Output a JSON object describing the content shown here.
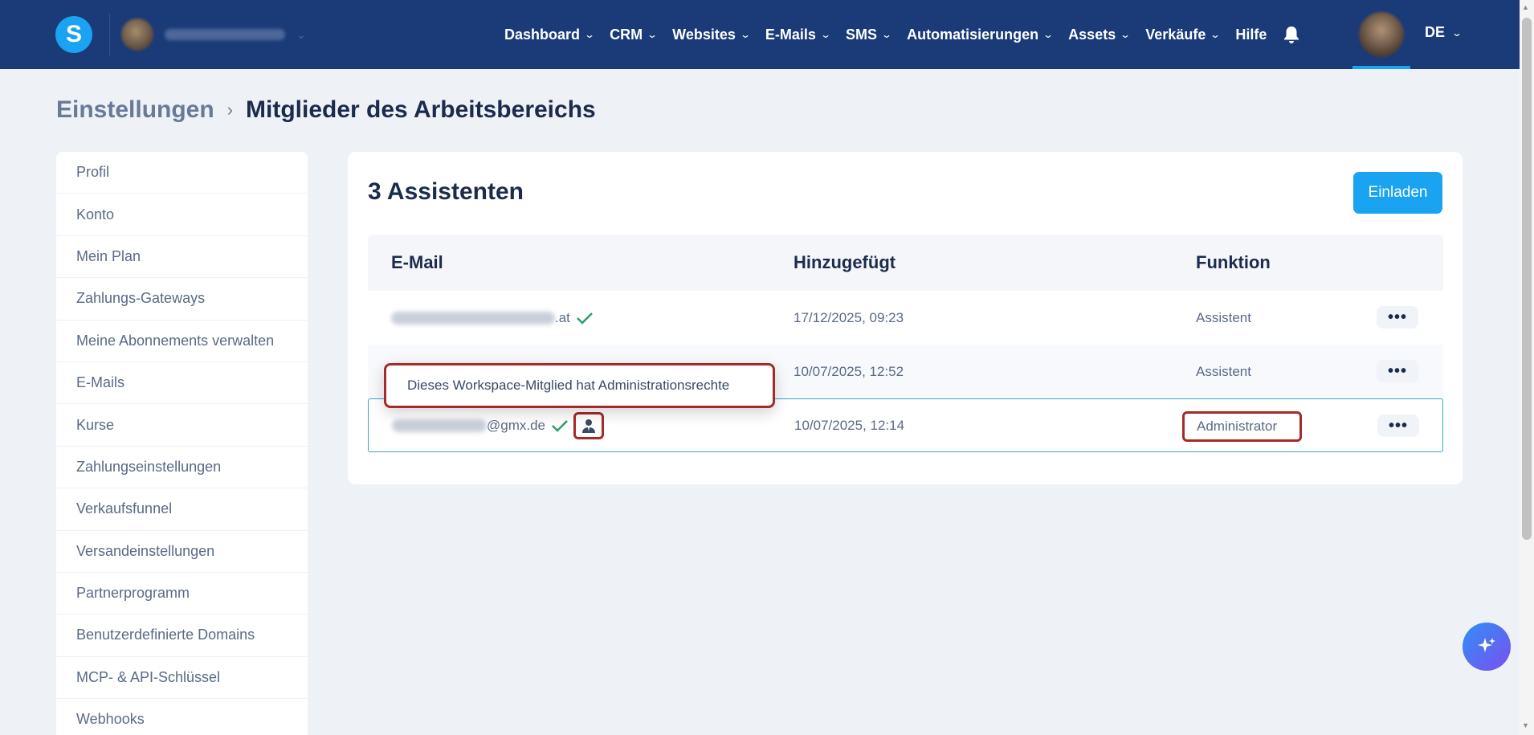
{
  "app": {
    "logo_letter": "S",
    "language": "DE"
  },
  "nav": {
    "items": [
      {
        "label": "Dashboard",
        "has_dropdown": true
      },
      {
        "label": "CRM",
        "has_dropdown": true
      },
      {
        "label": "Websites",
        "has_dropdown": true
      },
      {
        "label": "E-Mails",
        "has_dropdown": true
      },
      {
        "label": "SMS",
        "has_dropdown": true
      },
      {
        "label": "Automatisierungen",
        "has_dropdown": true
      },
      {
        "label": "Assets",
        "has_dropdown": true
      },
      {
        "label": "Verkäufe",
        "has_dropdown": true
      },
      {
        "label": "Hilfe",
        "has_dropdown": false
      }
    ]
  },
  "breadcrumb": {
    "root": "Einstellungen",
    "current": "Mitglieder des Arbeitsbereichs"
  },
  "sidebar": {
    "items": [
      {
        "label": "Profil"
      },
      {
        "label": "Konto"
      },
      {
        "label": "Mein Plan"
      },
      {
        "label": "Zahlungs-Gateways"
      },
      {
        "label": "Meine Abonnements verwalten"
      },
      {
        "label": "E-Mails"
      },
      {
        "label": "Kurse"
      },
      {
        "label": "Zahlungseinstellungen"
      },
      {
        "label": "Verkaufsfunnel"
      },
      {
        "label": "Versandeinstellungen"
      },
      {
        "label": "Partnerprogramm"
      },
      {
        "label": "Benutzerdefinierte Domains"
      },
      {
        "label": "MCP- & API-Schlüssel"
      },
      {
        "label": "Webhooks"
      }
    ]
  },
  "main": {
    "title": "3 Assistenten",
    "invite_label": "Einladen",
    "table": {
      "headers": {
        "email": "E-Mail",
        "added": "Hinzugefügt",
        "role": "Funktion"
      },
      "rows": [
        {
          "email_domain": ".at",
          "verified": true,
          "added": "17/12/2025, 09:23",
          "role": "Assistent"
        },
        {
          "email_domain": "",
          "verified": true,
          "added": "10/07/2025, 12:52",
          "role": "Assistent"
        },
        {
          "email_domain": "@gmx.de",
          "verified": true,
          "admin": true,
          "added": "10/07/2025, 12:14",
          "role": "Administrator"
        }
      ],
      "more_label": "•••"
    },
    "tooltip": "Dieses Workspace-Mitglied hat Administrationsrechte"
  },
  "colors": {
    "nav_bg": "#1a3a78",
    "accent": "#1aa3f0",
    "highlight": "#a52a2a",
    "check": "#2e9e6b"
  }
}
